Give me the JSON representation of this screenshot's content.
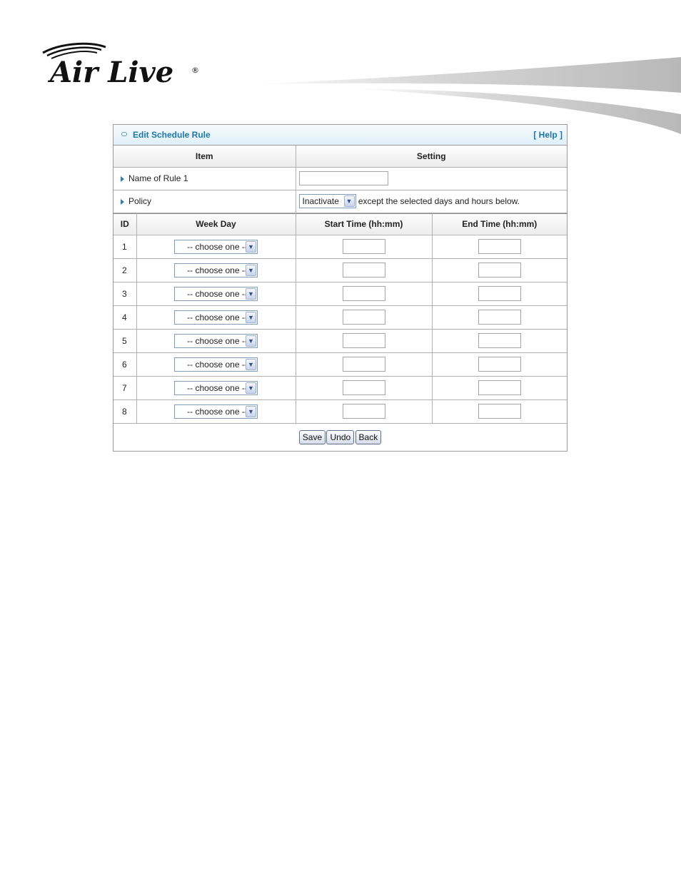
{
  "brand": {
    "logo_text": "Air Live",
    "registered_mark": "®"
  },
  "panel": {
    "title": "Edit Schedule Rule",
    "help_link": "[ Help ]"
  },
  "settings_table": {
    "col_item": "Item",
    "col_setting": "Setting",
    "name_label": "Name of Rule 1",
    "name_value": "",
    "policy_label": "Policy",
    "policy_selected": "Inactivate",
    "policy_tail": "except the selected days and hours below."
  },
  "schedule_table": {
    "col_id": "ID",
    "col_week_day": "Week Day",
    "col_start": "Start Time (hh:mm)",
    "col_end": "End Time (hh:mm)",
    "rows": [
      {
        "id": "1",
        "week_day": "-- choose one --",
        "start": "",
        "end": ""
      },
      {
        "id": "2",
        "week_day": "-- choose one --",
        "start": "",
        "end": ""
      },
      {
        "id": "3",
        "week_day": "-- choose one --",
        "start": "",
        "end": ""
      },
      {
        "id": "4",
        "week_day": "-- choose one --",
        "start": "",
        "end": ""
      },
      {
        "id": "5",
        "week_day": "-- choose one --",
        "start": "",
        "end": ""
      },
      {
        "id": "6",
        "week_day": "-- choose one --",
        "start": "",
        "end": ""
      },
      {
        "id": "7",
        "week_day": "-- choose one --",
        "start": "",
        "end": ""
      },
      {
        "id": "8",
        "week_day": "-- choose one --",
        "start": "",
        "end": ""
      }
    ]
  },
  "buttons": {
    "save": "Save",
    "undo": "Undo",
    "back": "Back"
  },
  "icons": {
    "dropdown": "chevron-down-icon",
    "row_marker": "triangle-right-icon",
    "title_marker": "bullet-icon"
  },
  "colors": {
    "title_text": "#1e77a8",
    "title_bg": "#dff0f8",
    "header_bg": "#ececec",
    "border": "#b0b0b0"
  }
}
